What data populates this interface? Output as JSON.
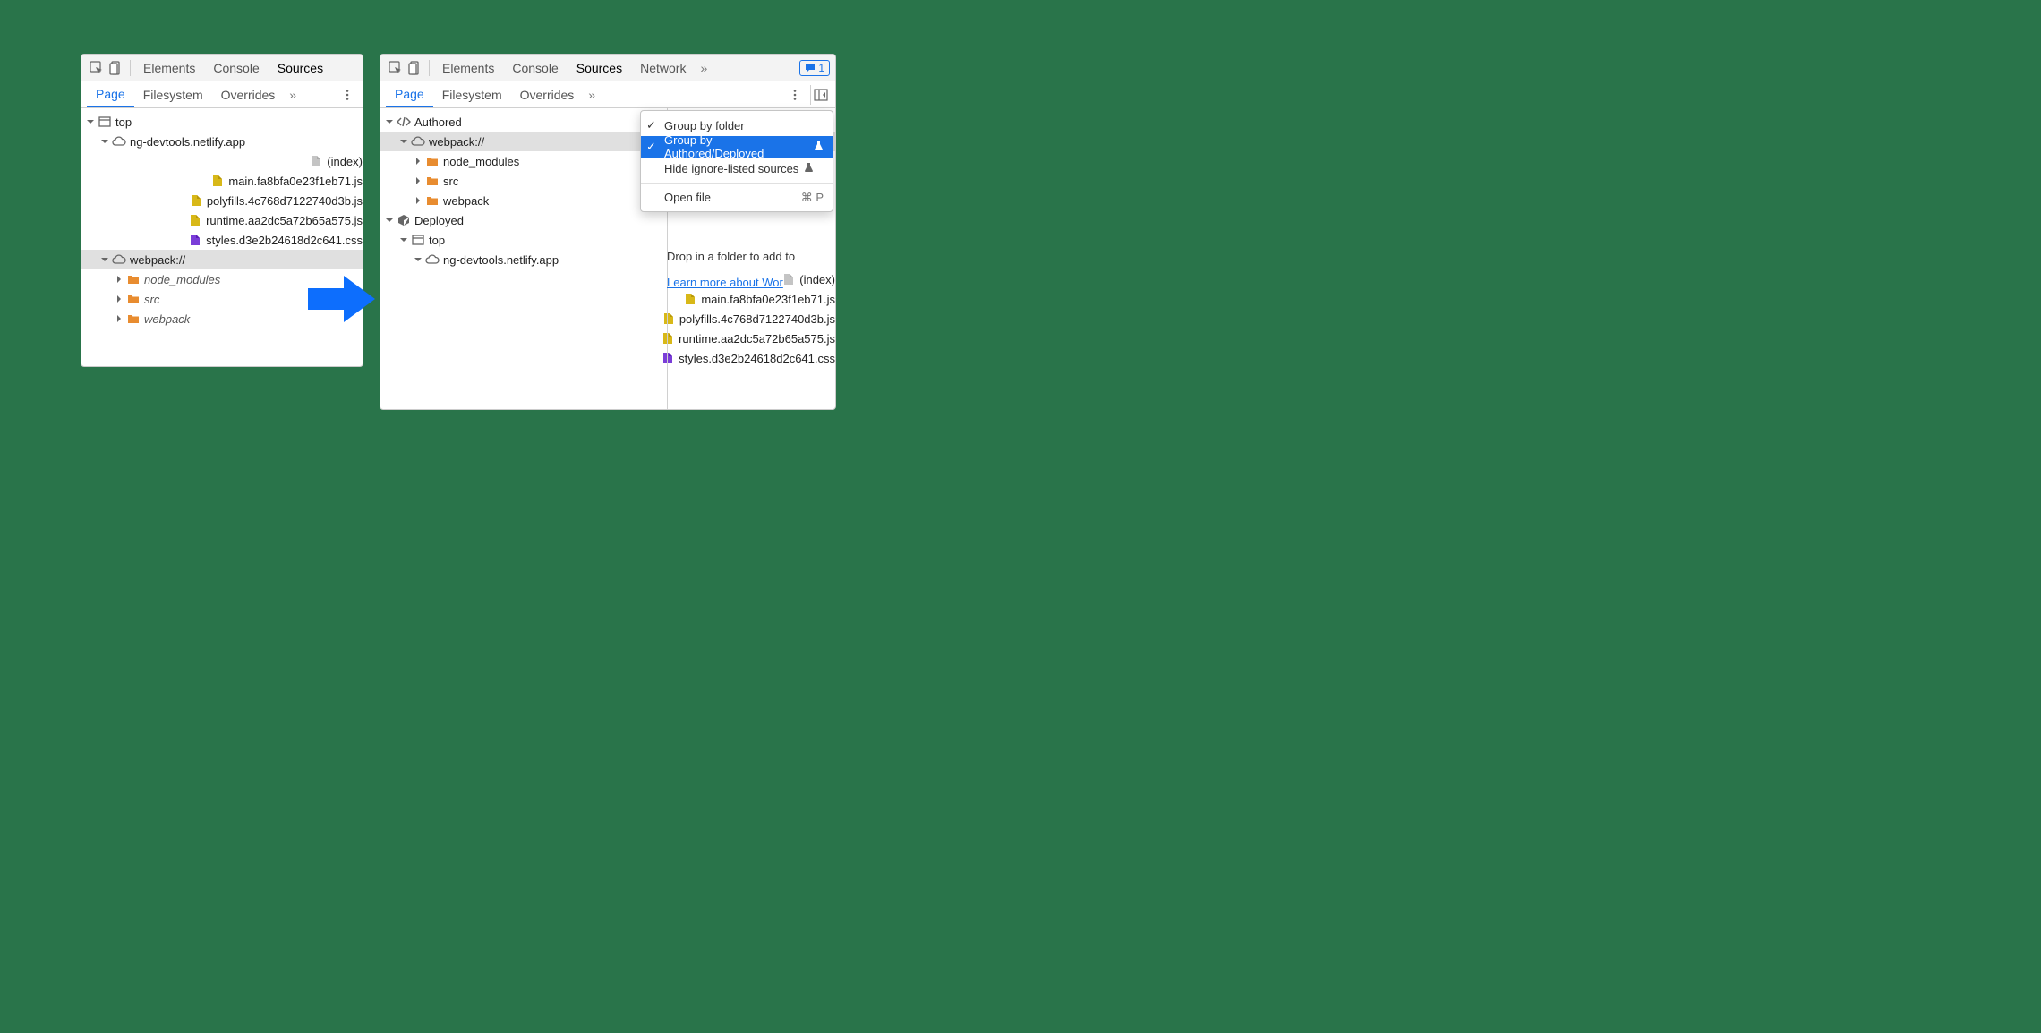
{
  "left": {
    "main_tabs": [
      "Elements",
      "Console",
      "Sources"
    ],
    "main_active": "Sources",
    "sub_tabs": [
      "Page",
      "Filesystem",
      "Overrides"
    ],
    "sub_active": "Page",
    "tree": {
      "top": "top",
      "domain": "ng-devtools.netlify.app",
      "files": [
        "(index)",
        "main.fa8bfa0e23f1eb71.js",
        "polyfills.4c768d7122740d3b.js",
        "runtime.aa2dc5a72b65a575.js",
        "styles.d3e2b24618d2c641.css"
      ],
      "webpack": "webpack://",
      "webpack_dirs": [
        "node_modules",
        "src",
        "webpack"
      ]
    }
  },
  "right": {
    "main_tabs": [
      "Elements",
      "Console",
      "Sources",
      "Network"
    ],
    "main_active": "Sources",
    "sub_tabs": [
      "Page",
      "Filesystem",
      "Overrides"
    ],
    "sub_active": "Page",
    "feedback_count": "1",
    "tree": {
      "authored": "Authored",
      "webpack": "webpack://",
      "webpack_dirs": [
        "node_modules",
        "src",
        "webpack"
      ],
      "deployed": "Deployed",
      "top": "top",
      "domain": "ng-devtools.netlify.app",
      "files": [
        "(index)",
        "main.fa8bfa0e23f1eb71.js",
        "polyfills.4c768d7122740d3b.js",
        "runtime.aa2dc5a72b65a575.js",
        "styles.d3e2b24618d2c641.css"
      ]
    },
    "menu": {
      "group_folder": "Group by folder",
      "group_authored": "Group by Authored/Deployed",
      "hide_ignore": "Hide ignore-listed sources",
      "open_file": "Open file",
      "open_file_shortcut": "⌘ P"
    },
    "hint_line1": "Drop in a folder to add to",
    "hint_link": "Learn more about Wor"
  }
}
